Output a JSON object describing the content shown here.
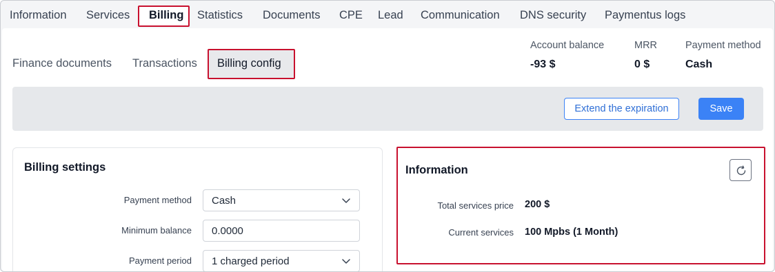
{
  "top_tabs": [
    {
      "label": "Information"
    },
    {
      "label": "Services"
    },
    {
      "label": "Billing",
      "active": true
    },
    {
      "label": "Statistics"
    },
    {
      "label": "Documents"
    },
    {
      "label": "CPE"
    },
    {
      "label": "Lead"
    },
    {
      "label": "Communication"
    },
    {
      "label": "DNS security"
    },
    {
      "label": "Paymentus logs"
    }
  ],
  "sub_tabs": [
    {
      "label": "Finance documents"
    },
    {
      "label": "Transactions"
    },
    {
      "label": "Billing config",
      "active": true
    }
  ],
  "summary": {
    "account_balance": {
      "label": "Account balance",
      "value": "-93 $"
    },
    "mrr": {
      "label": "MRR",
      "value": "0 $"
    },
    "payment_method": {
      "label": "Payment method",
      "value": "Cash"
    }
  },
  "actions": {
    "extend_label": "Extend the expiration",
    "save_label": "Save"
  },
  "billing_settings": {
    "title": "Billing settings",
    "fields": [
      {
        "label": "Payment method",
        "value": "Cash",
        "type": "select"
      },
      {
        "label": "Minimum balance",
        "value": "0.0000",
        "type": "input"
      },
      {
        "label": "Payment period",
        "value": "1 charged period",
        "type": "select"
      }
    ]
  },
  "information": {
    "title": "Information",
    "rows": [
      {
        "label": "Total services price",
        "value": "200 $"
      },
      {
        "label": "Current services",
        "value": "100 Mpbs (1 Month)"
      }
    ]
  },
  "icons": {
    "refresh": "refresh-icon",
    "chevron": "chevron-down-icon"
  },
  "colors": {
    "accent": "#3b82f6",
    "highlight": "#c8102e"
  }
}
